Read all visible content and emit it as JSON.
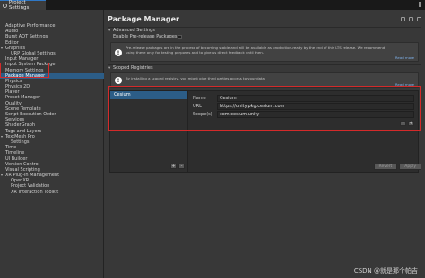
{
  "window": {
    "tab_title": "Project Settings"
  },
  "sidebar": {
    "items": [
      {
        "label": "Adaptive Performance",
        "indent": 0,
        "arrow": ""
      },
      {
        "label": "Audio",
        "indent": 0,
        "arrow": ""
      },
      {
        "label": "Burst AOT Settings",
        "indent": 0,
        "arrow": ""
      },
      {
        "label": "Editor",
        "indent": 0,
        "arrow": ""
      },
      {
        "label": "Graphics",
        "indent": 0,
        "arrow": "▾"
      },
      {
        "label": "URP Global Settings",
        "indent": 1,
        "arrow": ""
      },
      {
        "label": "Input Manager",
        "indent": 0,
        "arrow": ""
      },
      {
        "label": "Input System Package",
        "indent": 0,
        "arrow": ""
      },
      {
        "label": "Memory Settings",
        "indent": 0,
        "arrow": ""
      },
      {
        "label": "Package Manager",
        "indent": 0,
        "arrow": "",
        "selected": true
      },
      {
        "label": "Physics",
        "indent": 0,
        "arrow": ""
      },
      {
        "label": "Physics 2D",
        "indent": 0,
        "arrow": ""
      },
      {
        "label": "Player",
        "indent": 0,
        "arrow": ""
      },
      {
        "label": "Preset Manager",
        "indent": 0,
        "arrow": ""
      },
      {
        "label": "Quality",
        "indent": 0,
        "arrow": ""
      },
      {
        "label": "Scene Template",
        "indent": 0,
        "arrow": ""
      },
      {
        "label": "Script Execution Order",
        "indent": 0,
        "arrow": ""
      },
      {
        "label": "Services",
        "indent": 0,
        "arrow": ""
      },
      {
        "label": "ShaderGraph",
        "indent": 0,
        "arrow": ""
      },
      {
        "label": "Tags and Layers",
        "indent": 0,
        "arrow": ""
      },
      {
        "label": "TextMesh Pro",
        "indent": 0,
        "arrow": "▾"
      },
      {
        "label": "Settings",
        "indent": 1,
        "arrow": ""
      },
      {
        "label": "Time",
        "indent": 0,
        "arrow": ""
      },
      {
        "label": "Timeline",
        "indent": 0,
        "arrow": ""
      },
      {
        "label": "UI Builder",
        "indent": 0,
        "arrow": ""
      },
      {
        "label": "Version Control",
        "indent": 0,
        "arrow": ""
      },
      {
        "label": "Visual Scripting",
        "indent": 0,
        "arrow": ""
      },
      {
        "label": "XR Plug-in Management",
        "indent": 0,
        "arrow": "▾"
      },
      {
        "label": "OpenXR",
        "indent": 1,
        "arrow": ""
      },
      {
        "label": "Project Validation",
        "indent": 1,
        "arrow": ""
      },
      {
        "label": "XR Interaction Toolkit",
        "indent": 1,
        "arrow": ""
      }
    ]
  },
  "main": {
    "title": "Package Manager",
    "advanced": {
      "header": "Advanced Settings",
      "prerelease_label": "Enable Pre-release Packages",
      "help_text": "Pre-release packages are in the process of becoming stable and will be available as production-ready by the end of this LTS release. We recommend using these only for testing purposes and to give us direct feedback until then.",
      "read_more": "Read more"
    },
    "scoped": {
      "header": "Scoped Registries",
      "help_text": "By installing a scoped registry, you might give third parties access to your data.",
      "read_more": "Read more",
      "registries": [
        "Cesium"
      ],
      "form": {
        "name_label": "Name",
        "name_value": "Cesium",
        "url_label": "URL",
        "url_value": "https://unity.pkg.cesium.com",
        "scope_label": "Scope(s)",
        "scope_value": "com.cesium.unity"
      },
      "list_add": "+",
      "list_remove": "-",
      "scope_remove": "-",
      "scope_add": "+",
      "revert_label": "Revert",
      "apply_label": "Apply"
    }
  },
  "watermark": "CSDN @就是那个帕吉",
  "colors": {
    "selection": "#2c5d87",
    "highlight": "#d42a2a",
    "link": "#7fb0e8"
  }
}
